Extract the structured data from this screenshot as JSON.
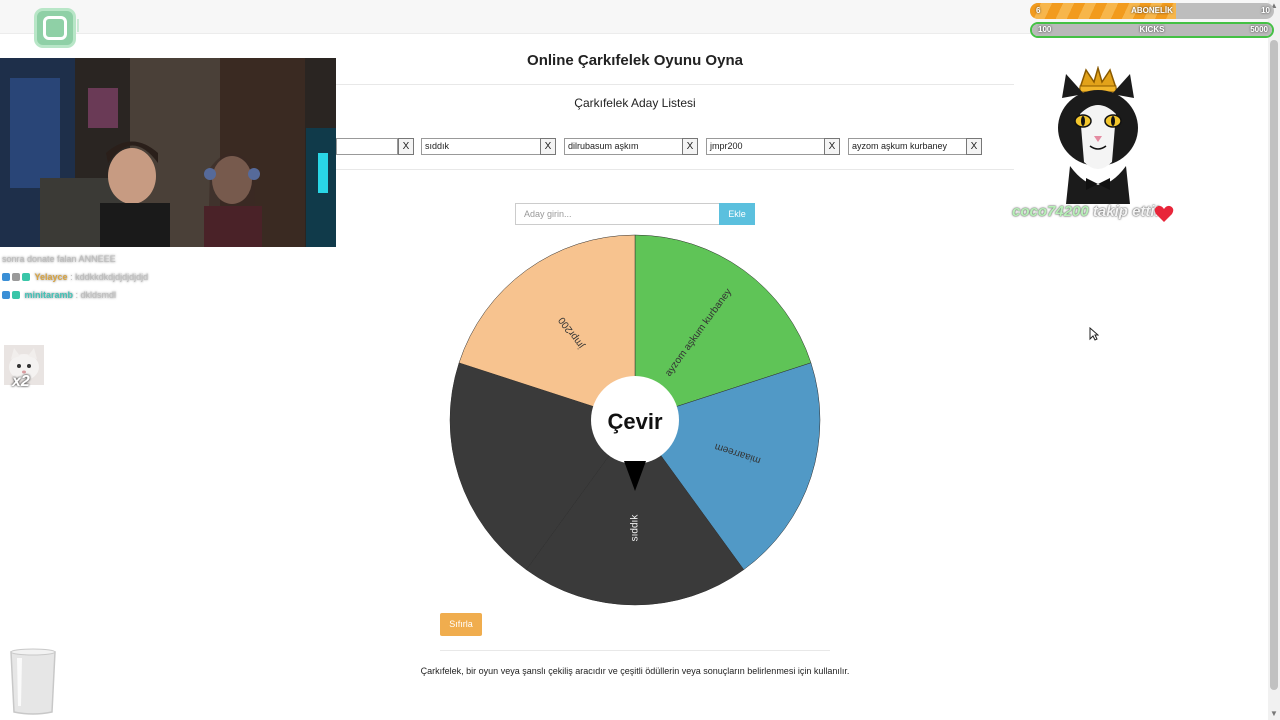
{
  "page": {
    "title": "Online Çarkıfelek Oyunu Oyna",
    "list_title": "Çarkıfelek Aday Listesi",
    "candidates": [
      {
        "name": "",
        "remove_label": "X"
      },
      {
        "name": "sıddık",
        "remove_label": "X"
      },
      {
        "name": "dilrubasum aşkım",
        "remove_label": "X"
      },
      {
        "name": "jmpr200",
        "remove_label": "X"
      },
      {
        "name": "ayzom aşkum kurbaney",
        "remove_label": "X"
      }
    ],
    "add_placeholder": "Aday girin...",
    "add_button": "Ekle",
    "spin_button": "Çevir",
    "reset_button": "Sıfırla",
    "description": "Çarkıfelek, bir oyun veya şanslı çekiliş aracıdır ve çeşitli ödüllerin veya sonuçların belirlenmesi için kullanılır."
  },
  "wheel": {
    "segments": [
      {
        "label": "ayzom aşkum kurbaney",
        "color": "#5fc457"
      },
      {
        "label": "miaarreem",
        "color": "#5199c6"
      },
      {
        "label": "sıddık",
        "color": "#3a3a3a"
      },
      {
        "label": "",
        "color": "#3a3a3a"
      },
      {
        "label": "jmpr200",
        "color": "#f7c38f"
      }
    ]
  },
  "overlay": {
    "subscription_bar": {
      "start": "6",
      "label": "ABONELİK",
      "goal": "10",
      "progress": 0.6
    },
    "kicks_bar": {
      "start": "100",
      "label": "KICKS",
      "goal": "5000",
      "progress": 0.0
    },
    "follow_user": "coco74200",
    "follow_text": "takip etti!",
    "emote_count": "x2",
    "chat": [
      {
        "user": "",
        "message": "sonra donate falan ANNEEE",
        "color": "#cccccc"
      },
      {
        "user": "Yelayce",
        "message": ": kddkkdkdjdjdjdjdjd",
        "color": "#d9a441"
      },
      {
        "user": "minitaramb",
        "message": ": dkldsmdl",
        "color": "#42c3b8"
      }
    ]
  }
}
